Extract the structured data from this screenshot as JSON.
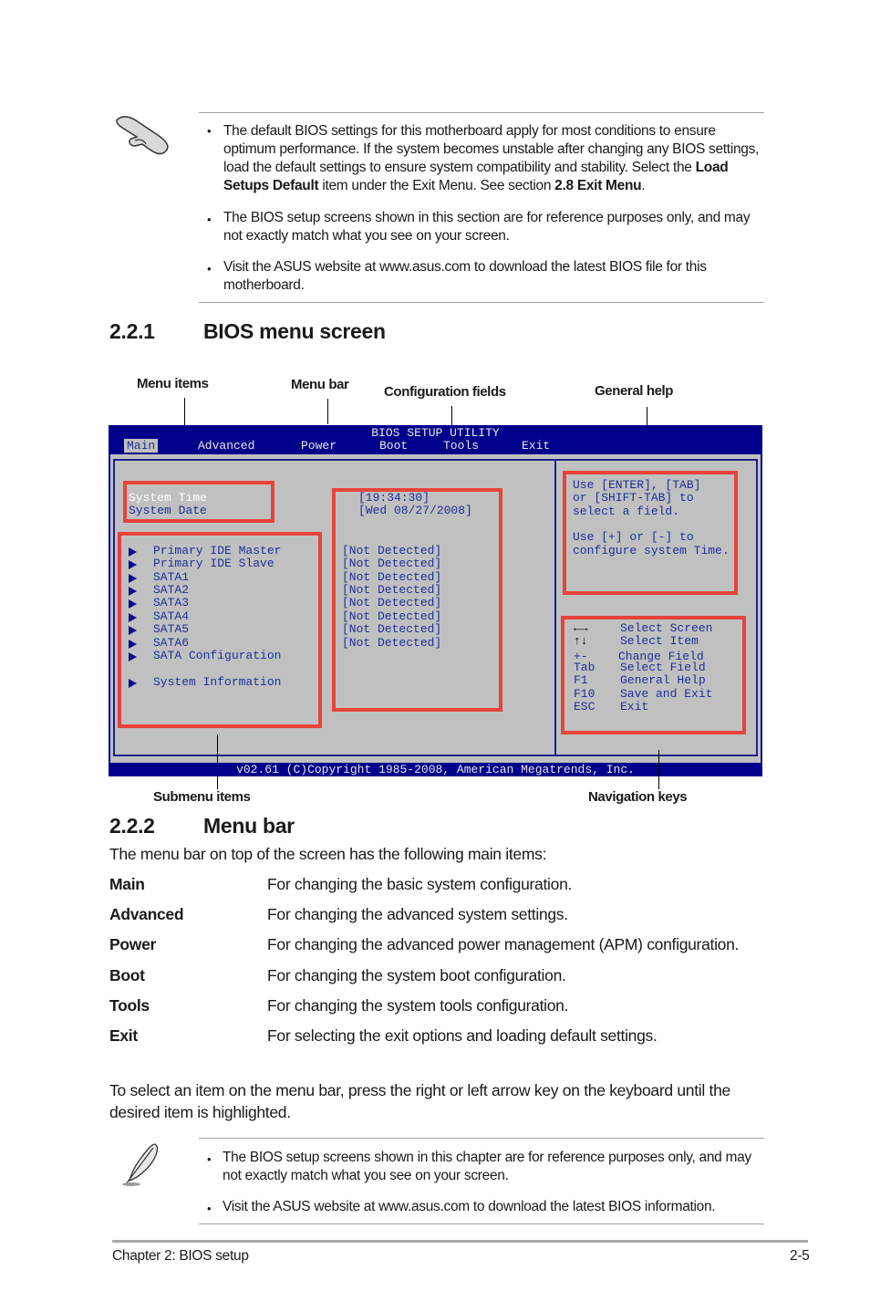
{
  "top_note": {
    "icon": "hand-pointer-icon",
    "bullets": [
      {
        "parts": [
          "The default BIOS settings for this motherboard apply for most conditions to ensure optimum performance. If the system becomes unstable after changing any BIOS settings, load the default settings to ensure system compatibility and stability. Select the ",
          "Load Setups Default",
          " item under the Exit Menu. See section ",
          "2.8 Exit Menu",
          "."
        ]
      },
      {
        "text": "The BIOS setup screens shown in this section are for reference purposes only, and may not exactly match what you see on your screen."
      },
      {
        "text": "Visit the ASUS website at www.asus.com to download the latest BIOS file for this motherboard."
      }
    ]
  },
  "section_221": {
    "number": "2.2.1",
    "title": "BIOS menu screen"
  },
  "callouts": {
    "menu_items": "Menu items",
    "menu_bar": "Menu bar",
    "config_fields": "Configuration fields",
    "general_help": "General help",
    "submenu_items": "Submenu items",
    "navigation_keys": "Navigation keys"
  },
  "bios": {
    "title": "BIOS SETUP UTILITY",
    "menu": [
      "Main",
      "Advanced",
      "Power",
      "Boot",
      "Tools",
      "Exit"
    ],
    "active_menu": "Main",
    "system_items": [
      "System Time",
      "System Date"
    ],
    "system_values": [
      "[19:34:30]",
      "[Wed 08/27/2008]"
    ],
    "submenu_items": [
      "Primary IDE Master",
      "Primary IDE Slave",
      "SATA1",
      "SATA2",
      "SATA3",
      "SATA4",
      "SATA5",
      "SATA6",
      "SATA Configuration",
      "System Information"
    ],
    "submenu_values": [
      "[Not Detected]",
      "[Not Detected]",
      "[Not Detected]",
      "[Not Detected]",
      "[Not Detected]",
      "[Not Detected]",
      "[Not Detected]",
      "[Not Detected]"
    ],
    "help_lines": [
      "Use [ENTER], [TAB]",
      "or [SHIFT-TAB] to",
      "select a field.",
      "",
      "Use [+] or [-] to",
      "configure system Time."
    ],
    "nav_keys": [
      {
        "key": "←→",
        "action": "Select Screen"
      },
      {
        "key": "↑↓",
        "action": "Select Item"
      },
      {
        "key": "+-",
        "action": "Change Field"
      },
      {
        "key": "Tab",
        "action": "Select Field"
      },
      {
        "key": "F1",
        "action": "General Help"
      },
      {
        "key": "F10",
        "action": "Save and Exit"
      },
      {
        "key": "ESC",
        "action": "Exit"
      }
    ],
    "footer": "v02.61 (C)Copyright 1985-2008, American Megatrends, Inc."
  },
  "section_222": {
    "number": "2.2.2",
    "title": "Menu bar"
  },
  "menu_bar_intro": "The menu bar on top of the screen has the following main items:",
  "menu_descriptions": [
    {
      "name": "Main",
      "desc": "For changing the basic system configuration."
    },
    {
      "name": "Advanced",
      "desc": "For changing the advanced system settings."
    },
    {
      "name": "Power",
      "desc": "For changing the advanced power management (APM) configuration."
    },
    {
      "name": "Boot",
      "desc": "For changing the system boot configuration."
    },
    {
      "name": "Tools",
      "desc": "For changing the system tools configuration."
    },
    {
      "name": "Exit",
      "desc": "For selecting the exit options and loading default settings."
    }
  ],
  "select_paragraph": "To select an item on the menu bar, press the right or left arrow key on the keyboard until the desired item is highlighted.",
  "bottom_note": {
    "icon": "quill-pen-icon",
    "bullets": [
      "The BIOS setup screens shown in this chapter are for reference purposes only, and may not exactly match what you see on your screen.",
      "Visit the ASUS website at www.asus.com to download the latest BIOS information."
    ]
  },
  "footer": {
    "chapter": "Chapter 2: BIOS setup",
    "page": "2-5"
  }
}
